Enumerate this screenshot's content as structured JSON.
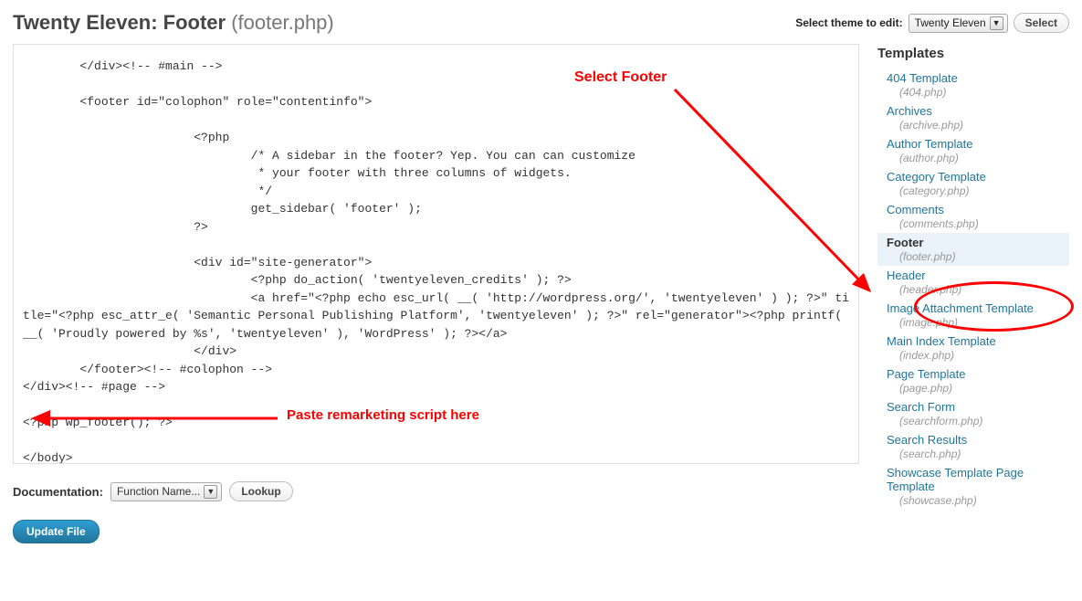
{
  "header": {
    "theme_name": "Twenty Eleven",
    "section": "Footer",
    "file": "(footer.php)",
    "select_label": "Select theme to edit:",
    "theme_dropdown_value": "Twenty Eleven",
    "select_button": "Select"
  },
  "editor": {
    "code": "        </div><!-- #main -->\n\n        <footer id=\"colophon\" role=\"contentinfo\">\n\n                        <?php\n                                /* A sidebar in the footer? Yep. You can can customize\n                                 * your footer with three columns of widgets.\n                                 */\n                                get_sidebar( 'footer' );\n                        ?>\n\n                        <div id=\"site-generator\">\n                                <?php do_action( 'twentyeleven_credits' ); ?>\n                                <a href=\"<?php echo esc_url( __( 'http://wordpress.org/', 'twentyeleven' ) ); ?>\" title=\"<?php esc_attr_e( 'Semantic Personal Publishing Platform', 'twentyeleven' ); ?>\" rel=\"generator\"><?php printf( __( 'Proudly powered by %s', 'twentyeleven' ), 'WordPress' ); ?></a>\n                        </div>\n        </footer><!-- #colophon -->\n</div><!-- #page -->\n\n<?php wp_footer(); ?>\n\n</body>\n</html>"
  },
  "documentation": {
    "label": "Documentation:",
    "dropdown_value": "Function Name...",
    "lookup_button": "Lookup"
  },
  "actions": {
    "update_button": "Update File"
  },
  "sidebar": {
    "heading": "Templates",
    "items": [
      {
        "label": "404 Template",
        "file": "(404.php)",
        "active": false
      },
      {
        "label": "Archives",
        "file": "(archive.php)",
        "active": false
      },
      {
        "label": "Author Template",
        "file": "(author.php)",
        "active": false
      },
      {
        "label": "Category Template",
        "file": "(category.php)",
        "active": false
      },
      {
        "label": "Comments",
        "file": "(comments.php)",
        "active": false
      },
      {
        "label": "Footer",
        "file": "(footer.php)",
        "active": true
      },
      {
        "label": "Header",
        "file": "(header.php)",
        "active": false
      },
      {
        "label": "Image Attachment Template",
        "file": "(image.php)",
        "active": false
      },
      {
        "label": "Main Index Template",
        "file": "(index.php)",
        "active": false
      },
      {
        "label": "Page Template",
        "file": "(page.php)",
        "active": false
      },
      {
        "label": "Search Form",
        "file": "(searchform.php)",
        "active": false
      },
      {
        "label": "Search Results",
        "file": "(search.php)",
        "active": false
      },
      {
        "label": "Showcase Template Page Template",
        "file": "(showcase.php)",
        "active": false
      }
    ]
  },
  "annotations": {
    "select_footer": "Select Footer",
    "paste_script": "Paste remarketing script here"
  }
}
